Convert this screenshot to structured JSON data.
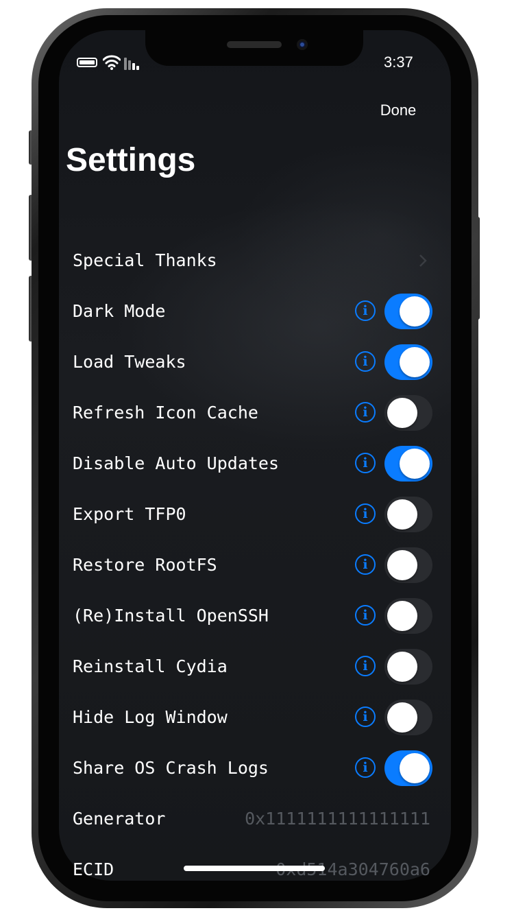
{
  "status_bar": {
    "time": "3:37"
  },
  "nav": {
    "done_label": "Done",
    "title": "Settings"
  },
  "rows": [
    {
      "label": "Special Thanks",
      "kind": "link"
    },
    {
      "label": "Dark Mode",
      "kind": "toggle",
      "on": true
    },
    {
      "label": "Load Tweaks",
      "kind": "toggle",
      "on": true
    },
    {
      "label": "Refresh Icon Cache",
      "kind": "toggle",
      "on": false
    },
    {
      "label": "Disable Auto Updates",
      "kind": "toggle",
      "on": true
    },
    {
      "label": "Export TFP0",
      "kind": "toggle",
      "on": false
    },
    {
      "label": "Restore RootFS",
      "kind": "toggle",
      "on": false
    },
    {
      "label": "(Re)Install OpenSSH",
      "kind": "toggle",
      "on": false
    },
    {
      "label": "Reinstall Cydia",
      "kind": "toggle",
      "on": false
    },
    {
      "label": "Hide Log Window",
      "kind": "toggle",
      "on": false
    },
    {
      "label": "Share OS Crash Logs",
      "kind": "toggle",
      "on": true
    },
    {
      "label": "Generator",
      "kind": "value",
      "value": "0x1111111111111111"
    },
    {
      "label": "ECID",
      "kind": "value",
      "value": "0xd514a304760a6"
    }
  ],
  "info_glyph": "i",
  "colors": {
    "accent": "#0a7cff",
    "toggle_off": "#2a2c30",
    "value_text": "#55595f"
  }
}
